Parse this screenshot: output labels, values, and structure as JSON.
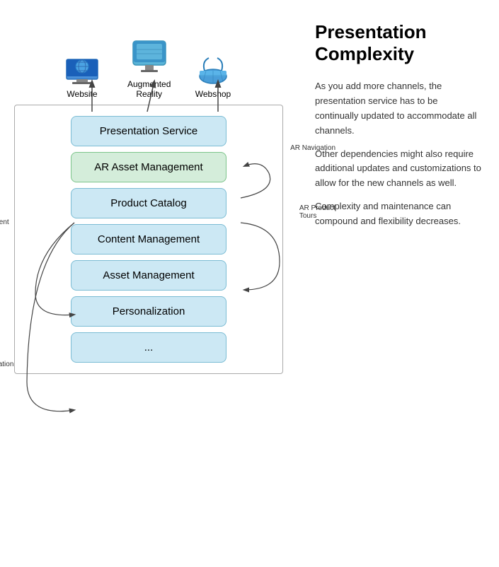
{
  "diagram": {
    "icons": [
      {
        "id": "website",
        "label": "Website",
        "type": "globe-monitor"
      },
      {
        "id": "ar",
        "label": "Augmented\nReality",
        "type": "ar-device"
      },
      {
        "id": "webshop",
        "label": "Webshop",
        "type": "basket"
      }
    ],
    "services": [
      {
        "id": "presentation-service",
        "label": "Presentation Service",
        "style": "blue"
      },
      {
        "id": "ar-asset-management",
        "label": "AR Asset Management",
        "style": "green"
      },
      {
        "id": "product-catalog",
        "label": "Product Catalog",
        "style": "blue"
      },
      {
        "id": "content-management",
        "label": "Content Management",
        "style": "blue"
      },
      {
        "id": "asset-management",
        "label": "Asset Management",
        "style": "blue"
      },
      {
        "id": "personalization",
        "label": "Personalization",
        "style": "blue"
      },
      {
        "id": "ellipsis",
        "label": "...",
        "style": "blue"
      }
    ],
    "arrow_labels": [
      {
        "id": "ar-navigation",
        "text": "AR Navigation"
      },
      {
        "id": "ar-product-tours",
        "text": "AR Product\nTours"
      },
      {
        "id": "ar-content",
        "text": "AR Content"
      },
      {
        "id": "ar-personalization",
        "text": "AR\nPersonalization"
      }
    ]
  },
  "text_panel": {
    "title": "Presentation\nComplexity",
    "paragraphs": [
      "As you add more channels, the presentation service has to be continually updated to accommodate all channels.",
      "Other dependencies might also require additional updates and customizations to allow for the new channels as well.",
      "Complexity and maintenance can compound and flexibility decreases."
    ]
  }
}
